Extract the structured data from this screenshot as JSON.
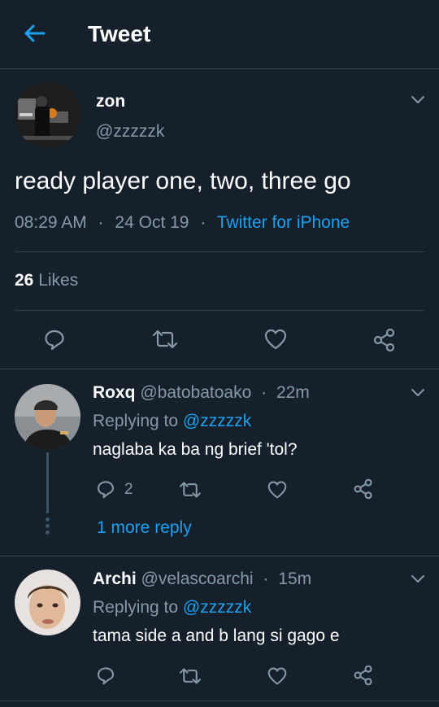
{
  "header": {
    "title": "Tweet",
    "back_icon": "arrow-left-icon"
  },
  "main_tweet": {
    "name": "zon",
    "handle": "@zzzzzk",
    "text": "ready player one, two, three go",
    "time": "08:29 AM",
    "sep1": "·",
    "date": "24 Oct 19",
    "sep2": "·",
    "source": "Twitter for iPhone",
    "likes_count": "26",
    "likes_label": "Likes"
  },
  "replies": [
    {
      "name": "Roxq",
      "handle": "@batobatoako",
      "sep": "·",
      "time": "22m",
      "replying_prefix": "Replying to",
      "replying_to": "@zzzzzk",
      "text": "naglaba ka ba ng brief 'tol?",
      "reply_count": "2",
      "more_replies": "1 more reply"
    },
    {
      "name": "Archi",
      "handle": "@velascoarchi",
      "sep": "·",
      "time": "15m",
      "replying_prefix": "Replying to",
      "replying_to": "@zzzzzk",
      "text": "tama side a and b lang si gago e"
    }
  ],
  "colors": {
    "background": "#15202b",
    "accent": "#1da1f2",
    "muted": "#8899a6",
    "divider": "#38444d"
  }
}
